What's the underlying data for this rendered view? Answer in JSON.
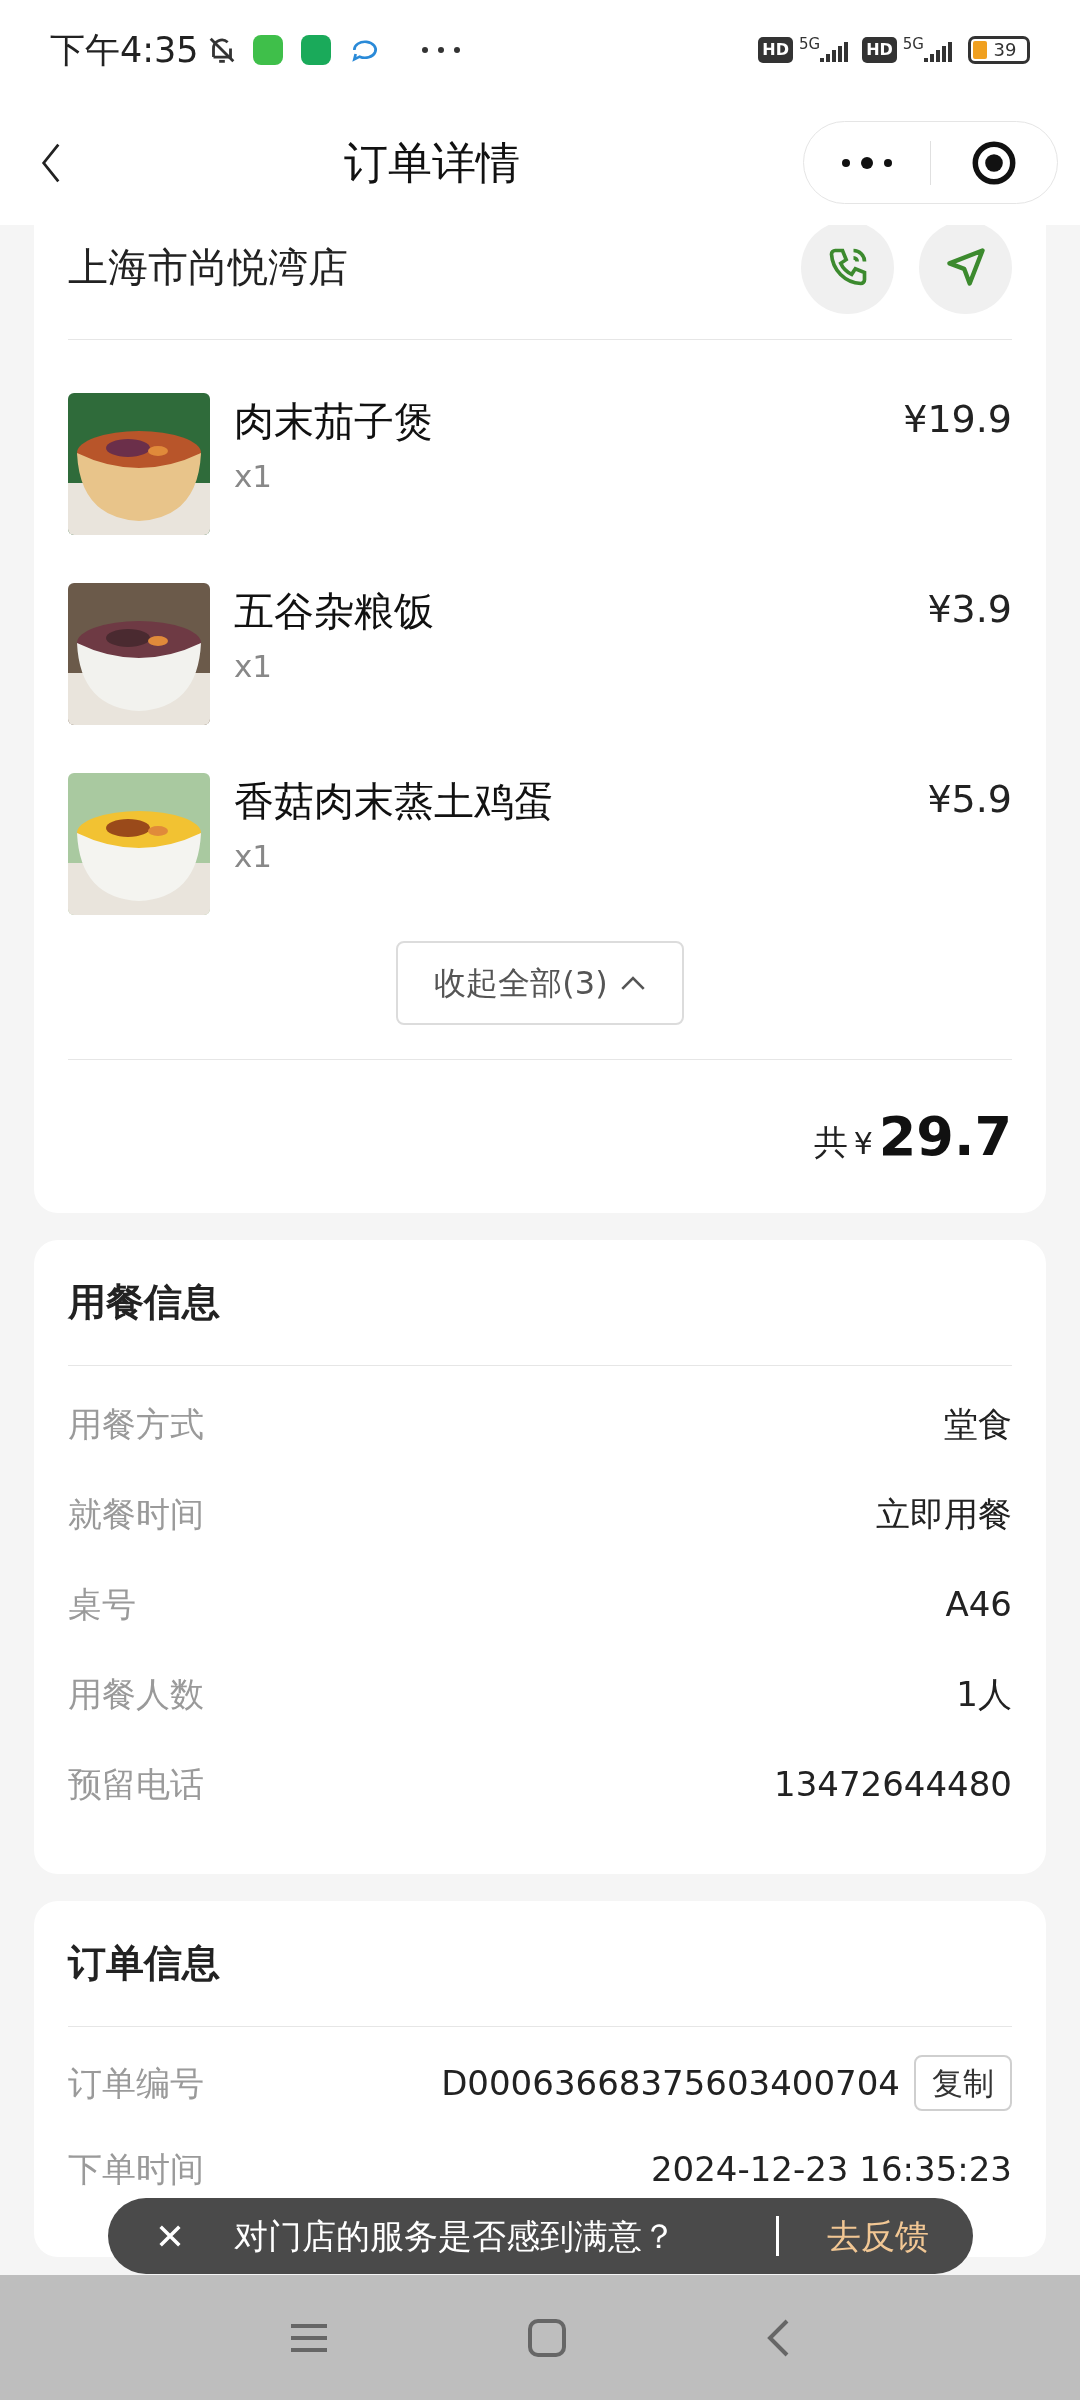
{
  "status_bar": {
    "time": "下午4:35",
    "sims": [
      {
        "hd": "HD",
        "network": "5G"
      },
      {
        "hd": "HD",
        "network": "5G"
      }
    ],
    "battery": "39"
  },
  "nav": {
    "title": "订单详情"
  },
  "store": {
    "name": "上海市尚悦湾店"
  },
  "items": [
    {
      "name": "肉末茄子煲",
      "qty": "x1",
      "price": "¥19.9"
    },
    {
      "name": "五谷杂粮饭",
      "qty": "x1",
      "price": "¥3.9"
    },
    {
      "name": "香菇肉末蒸土鸡蛋",
      "qty": "x1",
      "price": "¥5.9"
    }
  ],
  "collapse_button": "收起全部(3)",
  "total": {
    "prefix": "共",
    "currency": "¥",
    "amount": "29.7"
  },
  "dining_info": {
    "title": "用餐信息",
    "rows": [
      {
        "label": "用餐方式",
        "value": "堂食"
      },
      {
        "label": "就餐时间",
        "value": "立即用餐"
      },
      {
        "label": "桌号",
        "value": "A46"
      },
      {
        "label": "用餐人数",
        "value": "1人"
      },
      {
        "label": "预留电话",
        "value": "13472644480"
      }
    ]
  },
  "order_info": {
    "title": "订单信息",
    "rows": [
      {
        "label": "订单编号",
        "value": "D00063668375603400704",
        "action": "复制"
      },
      {
        "label": "下单时间",
        "value": "2024-12-23 16:35:23"
      }
    ]
  },
  "toast": {
    "message": "对门店的服务是否感到满意？",
    "action": "去反馈"
  }
}
